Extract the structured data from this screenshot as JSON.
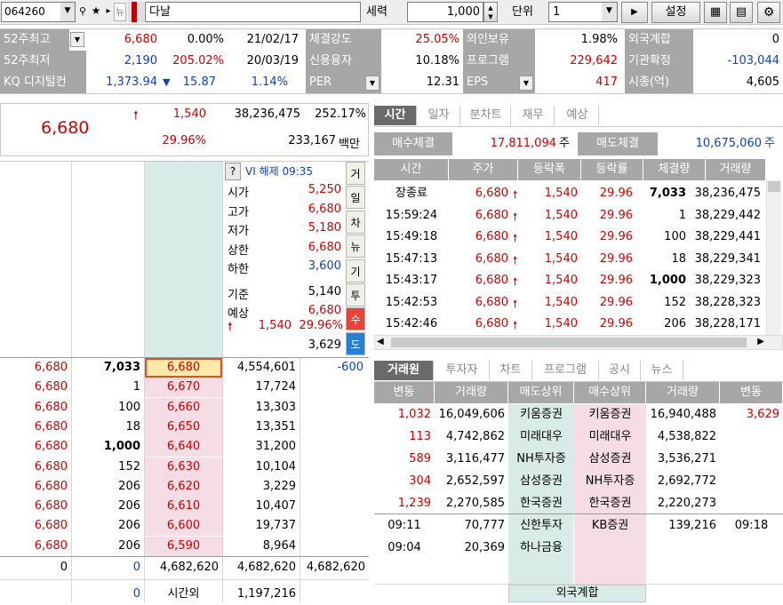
{
  "toolbar": {
    "code": "064260",
    "news_icon": "뉴",
    "name": "다날",
    "seryeok": "세력",
    "qty": "1,000",
    "unit_label": "단위",
    "unit_value": "1",
    "setting": "설정"
  },
  "info": {
    "r1": {
      "l1": "52주최고",
      "v1": "6,680",
      "p1": "0.00%",
      "d1": "21/02/17",
      "l2": "체결강도",
      "v2": "25.05%",
      "l3": "외인보유",
      "v3": "1.98%",
      "l4": "외국계합",
      "v4": "0"
    },
    "r2": {
      "l1": "52주최저",
      "v1": "2,190",
      "p1": "205.02%",
      "d1": "20/03/19",
      "l2": "신용융자",
      "v2": "10.18%",
      "l3": "프로그램",
      "v3": "229,642",
      "l4": "기관확정",
      "v4": "-103,044"
    },
    "r3": {
      "l1": "KQ 디지털컨",
      "v1": "1,373.94",
      "arrow": "▼",
      "chg": "15.87",
      "pct": "1.14%",
      "l2": "PER",
      "v2": "12.31",
      "l3": "EPS",
      "v3": "417",
      "l4": "시총(억)",
      "v4": "4,605"
    }
  },
  "price": {
    "current": "6,680",
    "change": "1,540",
    "volume": "38,236,475",
    "vol_ratio": "252.17%",
    "rate": "29.96%",
    "amount": "233,167",
    "amount_unit": "백만"
  },
  "tabs_top": [
    "시간",
    "일자",
    "분차트",
    "재무",
    "예상"
  ],
  "contract": {
    "buy_label": "매수체결",
    "buy_value": "17,811,094",
    "buy_unit": "주",
    "sell_label": "매도체결",
    "sell_value": "10,675,060",
    "sell_unit": "주"
  },
  "tick_headers": [
    "시간",
    "주가",
    "등락폭",
    "등락률",
    "체결량",
    "거래량"
  ],
  "ticks": [
    {
      "t": "장종료",
      "p": "6,680",
      "c": "1,540",
      "r": "29.96",
      "q": "7,033",
      "v": "38,236,475",
      "b": true
    },
    {
      "t": "15:59:24",
      "p": "6,680",
      "c": "1,540",
      "r": "29.96",
      "q": "1",
      "v": "38,229,442"
    },
    {
      "t": "15:49:18",
      "p": "6,680",
      "c": "1,540",
      "r": "29.96",
      "q": "100",
      "v": "38,229,441"
    },
    {
      "t": "15:47:13",
      "p": "6,680",
      "c": "1,540",
      "r": "29.96",
      "q": "18",
      "v": "38,229,341"
    },
    {
      "t": "15:43:17",
      "p": "6,680",
      "c": "1,540",
      "r": "29.96",
      "q": "1,000",
      "v": "38,229,323",
      "b": true
    },
    {
      "t": "15:42:53",
      "p": "6,680",
      "c": "1,540",
      "r": "29.96",
      "q": "152",
      "v": "38,228,323"
    },
    {
      "t": "15:42:46",
      "p": "6,680",
      "c": "1,540",
      "r": "29.96",
      "q": "206",
      "v": "38,228,171"
    }
  ],
  "summary": {
    "help": "?",
    "vi": "VI 해제 09:35",
    "items": [
      {
        "k": "시가",
        "v": "5,250"
      },
      {
        "k": "고가",
        "v": "6,680"
      },
      {
        "k": "저가",
        "v": "5,180"
      },
      {
        "k": "상한",
        "v": "6,680"
      },
      {
        "k": "하한",
        "v": "3,600"
      },
      {
        "k": "기준",
        "v": "5,140"
      },
      {
        "k": "예상",
        "v": "6,680"
      }
    ],
    "exp_change": "1,540",
    "exp_rate": "29.96%",
    "exp_qty": "3,629"
  },
  "side_buttons": [
    "거",
    "일",
    "차",
    "뉴",
    "기",
    "투",
    "수",
    "도"
  ],
  "orderbook": [
    {
      "p": "6,680",
      "q": "7,033",
      "bp": "6,680",
      "rem": "4,554,601",
      "diff": "-600"
    },
    {
      "p": "6,680",
      "q": "1",
      "bp": "6,670",
      "rem": "17,724"
    },
    {
      "p": "6,680",
      "q": "100",
      "bp": "6,660",
      "rem": "13,303"
    },
    {
      "p": "6,680",
      "q": "18",
      "bp": "6,650",
      "rem": "13,351"
    },
    {
      "p": "6,680",
      "q": "1,000",
      "bp": "6,640",
      "rem": "31,200"
    },
    {
      "p": "6,680",
      "q": "152",
      "bp": "6,630",
      "rem": "10,104"
    },
    {
      "p": "6,680",
      "q": "206",
      "bp": "6,620",
      "rem": "3,229"
    },
    {
      "p": "6,680",
      "q": "206",
      "bp": "6,610",
      "rem": "10,407"
    },
    {
      "p": "6,680",
      "q": "206",
      "bp": "6,600",
      "rem": "19,737"
    },
    {
      "p": "6,680",
      "q": "206",
      "bp": "6,590",
      "rem": "8,964"
    }
  ],
  "ob_total": {
    "a": "0",
    "b": "0",
    "c": "4,682,620",
    "d": "4,682,620",
    "e": "4,682,620"
  },
  "ob_after": {
    "b": "0",
    "label": "시간외",
    "d": "1,197,216"
  },
  "tabs_bottom": [
    "거래원",
    "투자자",
    "차트",
    "프로그램",
    "공시",
    "뉴스"
  ],
  "broker_headers": [
    "변동",
    "거래량",
    "매도상위",
    "매수상위",
    "거래량",
    "변동"
  ],
  "brokers": [
    {
      "sc": "1,032",
      "sv": "16,049,606",
      "sn": "키움증권",
      "bn": "키움증권",
      "bv": "16,940,488",
      "bc": "3,629"
    },
    {
      "sc": "113",
      "sv": "4,742,862",
      "sn": "미래대우",
      "bn": "미래대우",
      "bv": "4,538,822",
      "bc": ""
    },
    {
      "sc": "589",
      "sv": "3,116,477",
      "sn": "NH투자증",
      "bn": "삼성증권",
      "bv": "3,536,271",
      "bc": ""
    },
    {
      "sc": "304",
      "sv": "2,652,597",
      "sn": "삼성증권",
      "bn": "NH투자증",
      "bv": "2,692,772",
      "bc": ""
    },
    {
      "sc": "1,239",
      "sv": "2,270,585",
      "sn": "한국증권",
      "bn": "한국증권",
      "bv": "2,220,273",
      "bc": ""
    }
  ],
  "foreign": [
    {
      "t": "09:11",
      "v": "70,777",
      "sn": "신한투자",
      "bn": "KB증권",
      "bv": "139,216",
      "bt": "09:18"
    },
    {
      "t": "09:04",
      "v": "20,369",
      "sn": "하나금융",
      "bn": "",
      "bv": "",
      "bt": ""
    }
  ],
  "foreign_total": "외국계합"
}
